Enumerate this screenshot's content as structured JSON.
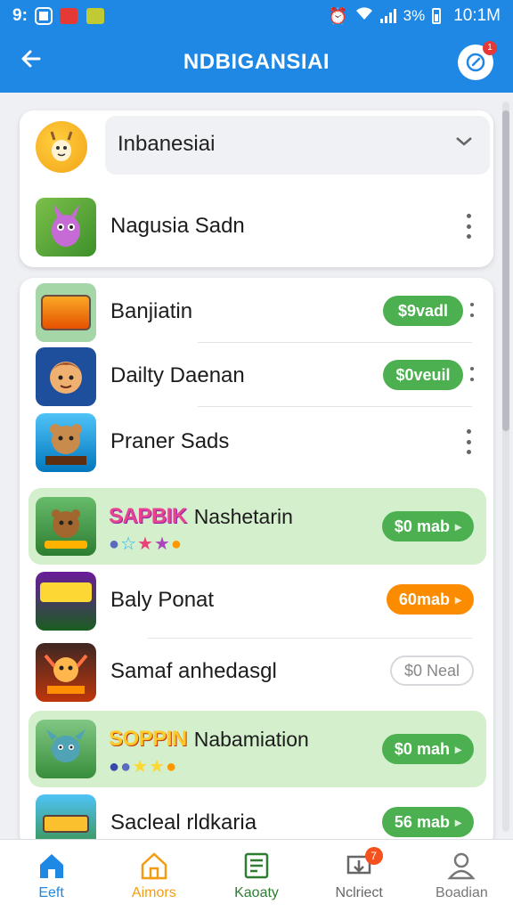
{
  "status_bar": {
    "left_text": "9:",
    "battery": "3%",
    "time": "10:1M"
  },
  "app_bar": {
    "title": "NDBIGANSIAI",
    "share_badge": "1"
  },
  "dropdown": {
    "label": "Inbanesiai"
  },
  "pinned_item": {
    "title": "Nagusia Sadn"
  },
  "list": [
    {
      "title": "Banjiatin",
      "action": "$9vadl",
      "style": "green",
      "menu": true
    },
    {
      "title": "Dailty Daenan",
      "action": "$0veuil",
      "style": "green",
      "menu": true
    },
    {
      "title": "Praner Sads",
      "action": "",
      "style": "none",
      "menu": true
    },
    {
      "promo": "SAPBIK",
      "title": "Nashetarin",
      "action": "$0 mab",
      "style": "green",
      "highlight": true
    },
    {
      "title": "Baly Ponat",
      "action": "60mab",
      "style": "orange"
    },
    {
      "title": "Samaf anhedasgl",
      "action": "$0 Neal",
      "style": "outline"
    },
    {
      "promo": "SOPPIN",
      "title": "Nabamiation",
      "action": "$0 mah",
      "style": "green",
      "highlight": true
    },
    {
      "title": "Sacleal rldkaria",
      "action": "56 mab",
      "style": "green"
    }
  ],
  "bottom_nav": [
    {
      "label": "Eeft",
      "icon": "home-icon",
      "color": "#1e88e5"
    },
    {
      "label": "Aimors",
      "icon": "house-outline-icon",
      "color": "#f39c12"
    },
    {
      "label": "Kaoaty",
      "icon": "news-icon",
      "color": "#2e7d32"
    },
    {
      "label": "Nclriect",
      "icon": "download-icon",
      "color": "#666666",
      "badge": "7"
    },
    {
      "label": "Boadian",
      "icon": "person-icon",
      "color": "#777777"
    }
  ],
  "colors": {
    "primary": "#1f88e5",
    "green": "#4caf50",
    "orange": "#fb8c00",
    "highlight": "#d3efcb"
  }
}
